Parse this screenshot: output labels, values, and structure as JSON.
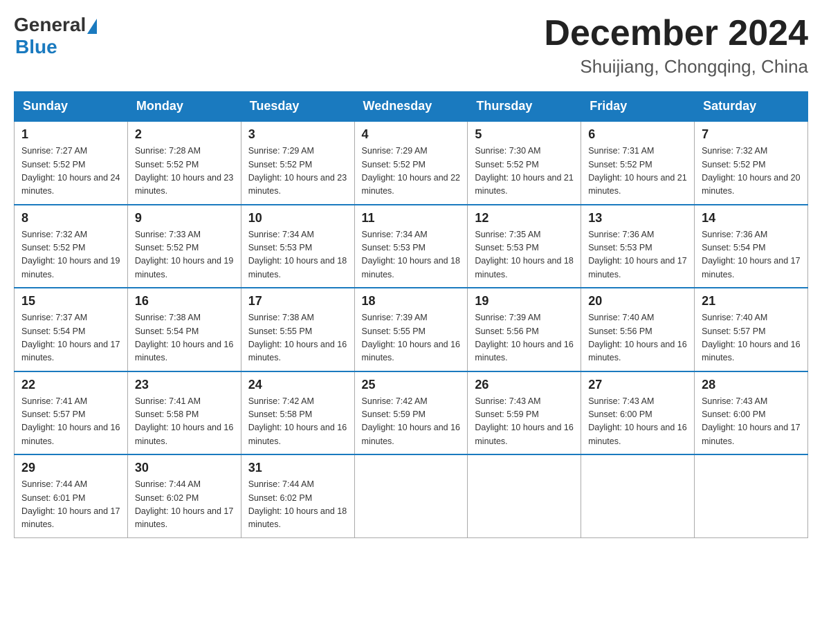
{
  "logo": {
    "general": "General",
    "blue": "Blue"
  },
  "title": "December 2024",
  "location": "Shuijiang, Chongqing, China",
  "days_of_week": [
    "Sunday",
    "Monday",
    "Tuesday",
    "Wednesday",
    "Thursday",
    "Friday",
    "Saturday"
  ],
  "weeks": [
    [
      {
        "day": "1",
        "sunrise": "7:27 AM",
        "sunset": "5:52 PM",
        "daylight": "10 hours and 24 minutes."
      },
      {
        "day": "2",
        "sunrise": "7:28 AM",
        "sunset": "5:52 PM",
        "daylight": "10 hours and 23 minutes."
      },
      {
        "day": "3",
        "sunrise": "7:29 AM",
        "sunset": "5:52 PM",
        "daylight": "10 hours and 23 minutes."
      },
      {
        "day": "4",
        "sunrise": "7:29 AM",
        "sunset": "5:52 PM",
        "daylight": "10 hours and 22 minutes."
      },
      {
        "day": "5",
        "sunrise": "7:30 AM",
        "sunset": "5:52 PM",
        "daylight": "10 hours and 21 minutes."
      },
      {
        "day": "6",
        "sunrise": "7:31 AM",
        "sunset": "5:52 PM",
        "daylight": "10 hours and 21 minutes."
      },
      {
        "day": "7",
        "sunrise": "7:32 AM",
        "sunset": "5:52 PM",
        "daylight": "10 hours and 20 minutes."
      }
    ],
    [
      {
        "day": "8",
        "sunrise": "7:32 AM",
        "sunset": "5:52 PM",
        "daylight": "10 hours and 19 minutes."
      },
      {
        "day": "9",
        "sunrise": "7:33 AM",
        "sunset": "5:52 PM",
        "daylight": "10 hours and 19 minutes."
      },
      {
        "day": "10",
        "sunrise": "7:34 AM",
        "sunset": "5:53 PM",
        "daylight": "10 hours and 18 minutes."
      },
      {
        "day": "11",
        "sunrise": "7:34 AM",
        "sunset": "5:53 PM",
        "daylight": "10 hours and 18 minutes."
      },
      {
        "day": "12",
        "sunrise": "7:35 AM",
        "sunset": "5:53 PM",
        "daylight": "10 hours and 18 minutes."
      },
      {
        "day": "13",
        "sunrise": "7:36 AM",
        "sunset": "5:53 PM",
        "daylight": "10 hours and 17 minutes."
      },
      {
        "day": "14",
        "sunrise": "7:36 AM",
        "sunset": "5:54 PM",
        "daylight": "10 hours and 17 minutes."
      }
    ],
    [
      {
        "day": "15",
        "sunrise": "7:37 AM",
        "sunset": "5:54 PM",
        "daylight": "10 hours and 17 minutes."
      },
      {
        "day": "16",
        "sunrise": "7:38 AM",
        "sunset": "5:54 PM",
        "daylight": "10 hours and 16 minutes."
      },
      {
        "day": "17",
        "sunrise": "7:38 AM",
        "sunset": "5:55 PM",
        "daylight": "10 hours and 16 minutes."
      },
      {
        "day": "18",
        "sunrise": "7:39 AM",
        "sunset": "5:55 PM",
        "daylight": "10 hours and 16 minutes."
      },
      {
        "day": "19",
        "sunrise": "7:39 AM",
        "sunset": "5:56 PM",
        "daylight": "10 hours and 16 minutes."
      },
      {
        "day": "20",
        "sunrise": "7:40 AM",
        "sunset": "5:56 PM",
        "daylight": "10 hours and 16 minutes."
      },
      {
        "day": "21",
        "sunrise": "7:40 AM",
        "sunset": "5:57 PM",
        "daylight": "10 hours and 16 minutes."
      }
    ],
    [
      {
        "day": "22",
        "sunrise": "7:41 AM",
        "sunset": "5:57 PM",
        "daylight": "10 hours and 16 minutes."
      },
      {
        "day": "23",
        "sunrise": "7:41 AM",
        "sunset": "5:58 PM",
        "daylight": "10 hours and 16 minutes."
      },
      {
        "day": "24",
        "sunrise": "7:42 AM",
        "sunset": "5:58 PM",
        "daylight": "10 hours and 16 minutes."
      },
      {
        "day": "25",
        "sunrise": "7:42 AM",
        "sunset": "5:59 PM",
        "daylight": "10 hours and 16 minutes."
      },
      {
        "day": "26",
        "sunrise": "7:43 AM",
        "sunset": "5:59 PM",
        "daylight": "10 hours and 16 minutes."
      },
      {
        "day": "27",
        "sunrise": "7:43 AM",
        "sunset": "6:00 PM",
        "daylight": "10 hours and 16 minutes."
      },
      {
        "day": "28",
        "sunrise": "7:43 AM",
        "sunset": "6:00 PM",
        "daylight": "10 hours and 17 minutes."
      }
    ],
    [
      {
        "day": "29",
        "sunrise": "7:44 AM",
        "sunset": "6:01 PM",
        "daylight": "10 hours and 17 minutes."
      },
      {
        "day": "30",
        "sunrise": "7:44 AM",
        "sunset": "6:02 PM",
        "daylight": "10 hours and 17 minutes."
      },
      {
        "day": "31",
        "sunrise": "7:44 AM",
        "sunset": "6:02 PM",
        "daylight": "10 hours and 18 minutes."
      },
      null,
      null,
      null,
      null
    ]
  ]
}
